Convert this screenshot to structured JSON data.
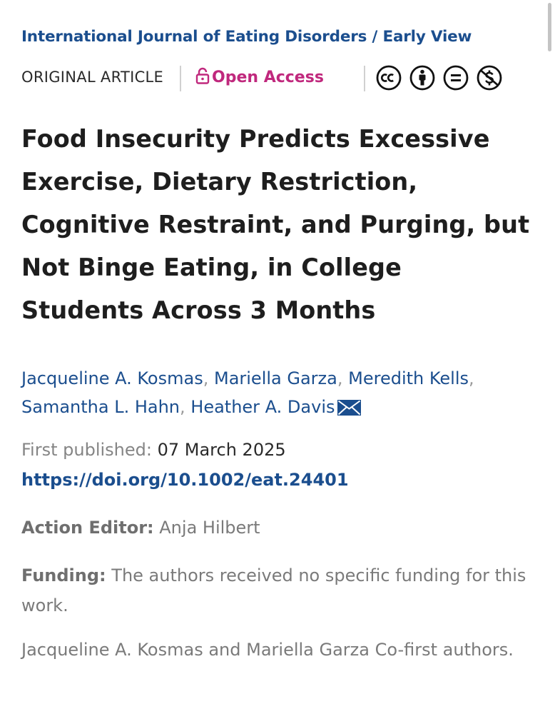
{
  "header": {
    "journal": "International Journal of Eating Disorders",
    "separator": " / ",
    "issue": "Early View",
    "article_type": "ORIGINAL ARTICLE",
    "open_access": "Open Access"
  },
  "license_icons": [
    "cc-icon",
    "by-icon",
    "nd-icon",
    "nc-icon"
  ],
  "title": "Food Insecurity Predicts Excessive Exercise, Dietary Restriction, Cognitive Restraint, and Purging, but Not Binge Eating, in College Students Across 3 Months",
  "authors": [
    "Jacqueline A. Kosmas",
    "Mariella Garza",
    "Meredith Kells",
    "Samantha L. Hahn",
    "Heather A. Davis"
  ],
  "published": {
    "label": "First published:",
    "date": "07 March 2025"
  },
  "doi": "https://doi.org/10.1002/eat.24401",
  "action_editor": {
    "label": "Action Editor:",
    "name": "Anja Hilbert"
  },
  "funding": {
    "label": "Funding:",
    "text": "The authors received no specific funding for this work."
  },
  "note": "Jacqueline A. Kosmas and Mariella Garza Co-first authors.",
  "colors": {
    "link": "#1b4e8e",
    "open_access": "#c0287d",
    "muted": "#7a7a7a"
  }
}
